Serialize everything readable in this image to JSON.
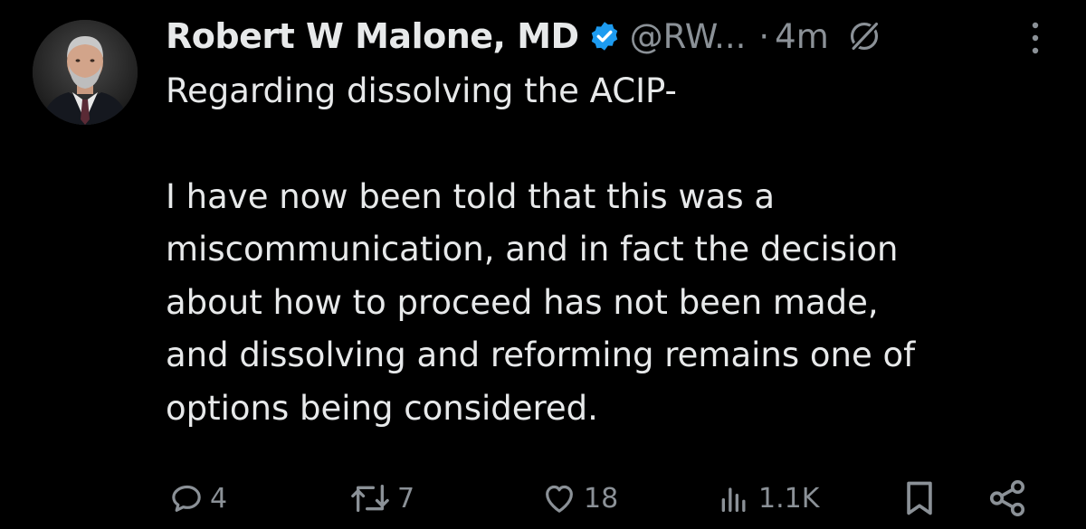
{
  "post": {
    "author_name": "Robert W Malone, MD",
    "handle": "@RW...",
    "separator": "·",
    "time": "4m",
    "lines": [
      "Regarding dissolving the ACIP-",
      "I have now been told that this was a",
      "miscommunication, and in fact the decision",
      "about how to proceed has not been made,",
      "and dissolving and reforming remains one of",
      "options being considered."
    ]
  },
  "actions": {
    "replies": "4",
    "reposts": "7",
    "likes": "18",
    "views": "1.1K"
  },
  "icons": {
    "verified": "verified-badge-icon",
    "grok": "grok-icon",
    "more": "more-vertical-icon",
    "reply": "reply-icon",
    "repost": "repost-icon",
    "like": "heart-icon",
    "views": "views-icon",
    "bookmark": "bookmark-icon",
    "share": "share-icon"
  },
  "colors": {
    "background": "#000000",
    "text": "#e7e9ea",
    "secondary": "#8b9197",
    "verified": "#1d9bf0"
  }
}
